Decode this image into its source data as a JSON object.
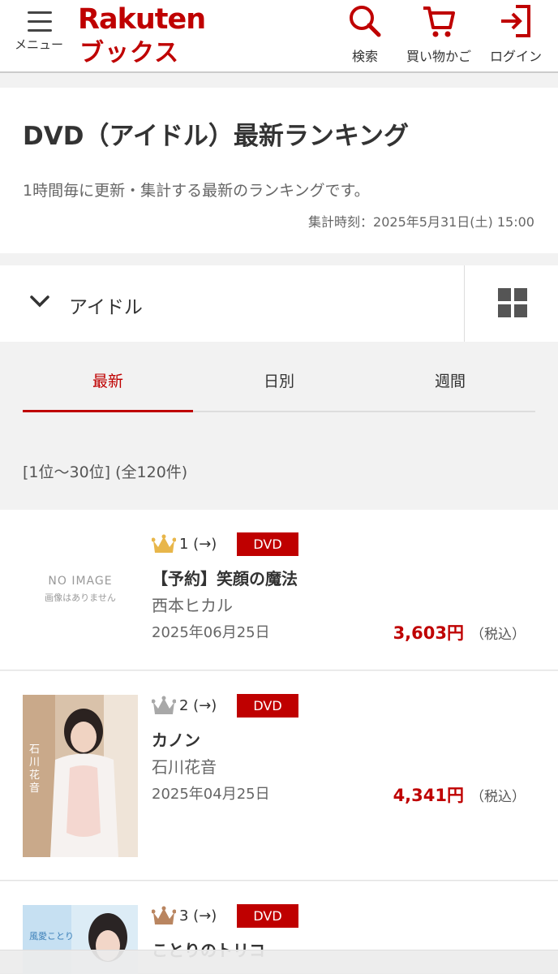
{
  "header": {
    "menu_label": "メニュー",
    "logo_en": "Rakuten",
    "logo_ja": "ブックス",
    "search_label": "検索",
    "cart_label": "買い物かご",
    "login_label": "ログイン",
    "brand_color": "#bf0000"
  },
  "page": {
    "title": "DVD（アイドル）最新ランキング",
    "description": "1時間毎に更新・集計する最新のランキングです。",
    "timestamp": "集計時刻：2025年5月31日(土) 15:00"
  },
  "category": {
    "selected": "アイドル",
    "chevron_icon": "chevron-down-icon",
    "grid_icon": "grid-view-icon"
  },
  "tabs": [
    {
      "label": "最新",
      "active": true
    },
    {
      "label": "日別",
      "active": false
    },
    {
      "label": "週間",
      "active": false
    }
  ],
  "range_text": "[1位〜30位] (全120件)",
  "items": [
    {
      "rank": "1 (→)",
      "badge": "DVD",
      "title": "【予約】笑顔の魔法",
      "artist": "西本ヒカル",
      "date": "2025年06月25日",
      "price": "3,603円",
      "tax": "（税込）",
      "no_image": "NO IMAGE",
      "no_image_sub": "画像はありません",
      "crown": "gold-crown-icon"
    },
    {
      "rank": "2 (→)",
      "badge": "DVD",
      "title": "カノン",
      "artist": "石川花音",
      "date": "2025年04月25日",
      "price": "4,341円",
      "tax": "（税込）",
      "crown": "silver-crown-icon",
      "cover_text": "石川花音"
    },
    {
      "rank": "3 (→)",
      "badge": "DVD",
      "title": "ことりのトリコ",
      "crown": "bronze-crown-icon",
      "cover_text": "風愛ことり"
    }
  ]
}
